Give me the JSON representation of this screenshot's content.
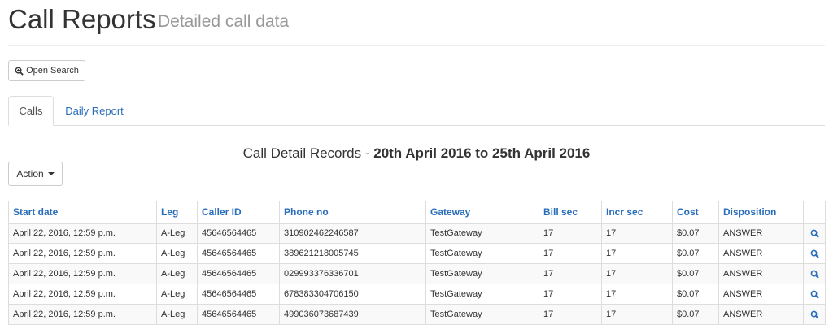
{
  "header": {
    "title": "Call Reports",
    "subtitle": "Detailed call data"
  },
  "toolbar": {
    "open_search_label": "Open Search",
    "action_label": "Action"
  },
  "tabs": [
    {
      "label": "Calls",
      "active": true
    },
    {
      "label": "Daily Report",
      "active": false
    }
  ],
  "report": {
    "heading_prefix": "Call Detail Records - ",
    "date_range": "20th April 2016 to 25th April 2016"
  },
  "table": {
    "columns": [
      "Start date",
      "Leg",
      "Caller ID",
      "Phone no",
      "Gateway",
      "Bill sec",
      "Incr sec",
      "Cost",
      "Disposition",
      ""
    ],
    "rows": [
      {
        "start_date": "April 22, 2016, 12:59 p.m.",
        "leg": "A-Leg",
        "caller_id": "45646564465",
        "phone_no": "310902462246587",
        "gateway": "TestGateway",
        "bill_sec": "17",
        "incr_sec": "17",
        "cost": "$0.07",
        "disposition": "ANSWER"
      },
      {
        "start_date": "April 22, 2016, 12:59 p.m.",
        "leg": "A-Leg",
        "caller_id": "45646564465",
        "phone_no": "389621218005745",
        "gateway": "TestGateway",
        "bill_sec": "17",
        "incr_sec": "17",
        "cost": "$0.07",
        "disposition": "ANSWER"
      },
      {
        "start_date": "April 22, 2016, 12:59 p.m.",
        "leg": "A-Leg",
        "caller_id": "45646564465",
        "phone_no": "029993376336701",
        "gateway": "TestGateway",
        "bill_sec": "17",
        "incr_sec": "17",
        "cost": "$0.07",
        "disposition": "ANSWER"
      },
      {
        "start_date": "April 22, 2016, 12:59 p.m.",
        "leg": "A-Leg",
        "caller_id": "45646564465",
        "phone_no": "678383304706150",
        "gateway": "TestGateway",
        "bill_sec": "17",
        "incr_sec": "17",
        "cost": "$0.07",
        "disposition": "ANSWER"
      },
      {
        "start_date": "April 22, 2016, 12:59 p.m.",
        "leg": "A-Leg",
        "caller_id": "45646564465",
        "phone_no": "499036073687439",
        "gateway": "TestGateway",
        "bill_sec": "17",
        "incr_sec": "17",
        "cost": "$0.07",
        "disposition": "ANSWER"
      }
    ]
  },
  "icons": {
    "search": "zoom-in-icon",
    "row_view": "search-icon",
    "dropdown": "caret-down-icon"
  },
  "colors": {
    "link": "#2a6ebb",
    "subtitle": "#999999",
    "border": "#dddddd",
    "stripe": "#f9f9f9"
  }
}
